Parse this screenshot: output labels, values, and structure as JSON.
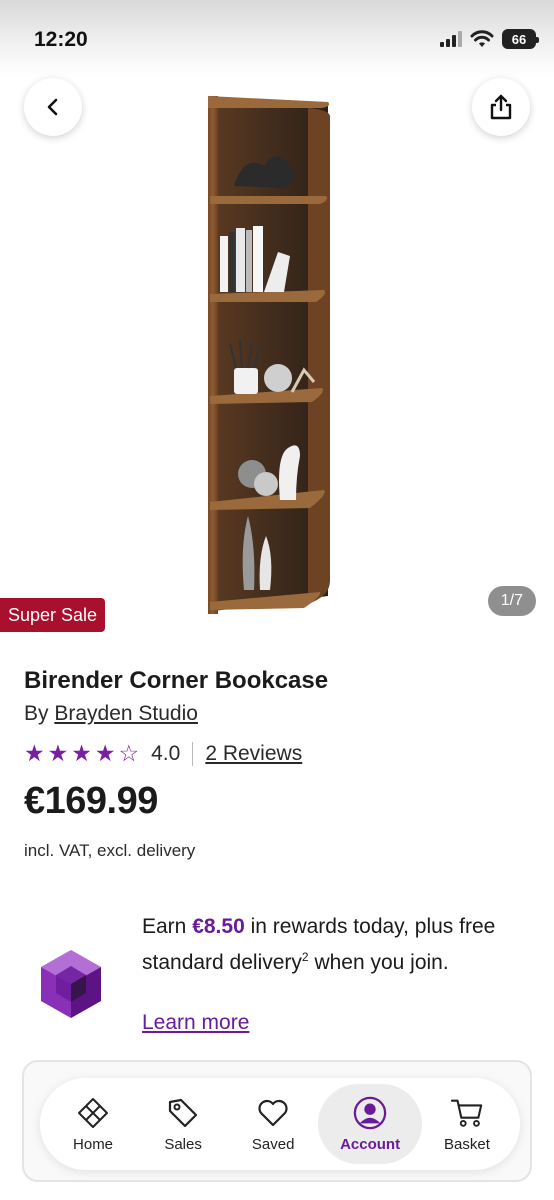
{
  "status_bar": {
    "time": "12:20",
    "battery": "66"
  },
  "hero": {
    "image_counter": "1/7",
    "sale_badge": "Super Sale"
  },
  "product": {
    "title": "Birender Corner Bookcase",
    "by_prefix": "By",
    "brand": "Brayden Studio",
    "rating_value": "4.0",
    "rating_stars": 4,
    "rating_max": 5,
    "reviews_link": "2 Reviews",
    "price": "€169.99",
    "vat_note": "incl. VAT, excl. delivery"
  },
  "rewards": {
    "text_before": "Earn ",
    "amount": "€8.50",
    "text_after": " in rewards today, plus free standard delivery",
    "superscript": "2",
    "text_end": " when you join.",
    "learn_more": "Learn more"
  },
  "bottom_nav": {
    "items": [
      {
        "label": "Home",
        "icon": "home-icon"
      },
      {
        "label": "Sales",
        "icon": "tag-icon"
      },
      {
        "label": "Saved",
        "icon": "heart-icon"
      },
      {
        "label": "Account",
        "icon": "account-icon",
        "active": true
      },
      {
        "label": "Basket",
        "icon": "cart-icon"
      }
    ]
  },
  "colors": {
    "accent": "#6a1b9a",
    "sale_badge": "#a8102e",
    "star": "#7b1fa2"
  }
}
